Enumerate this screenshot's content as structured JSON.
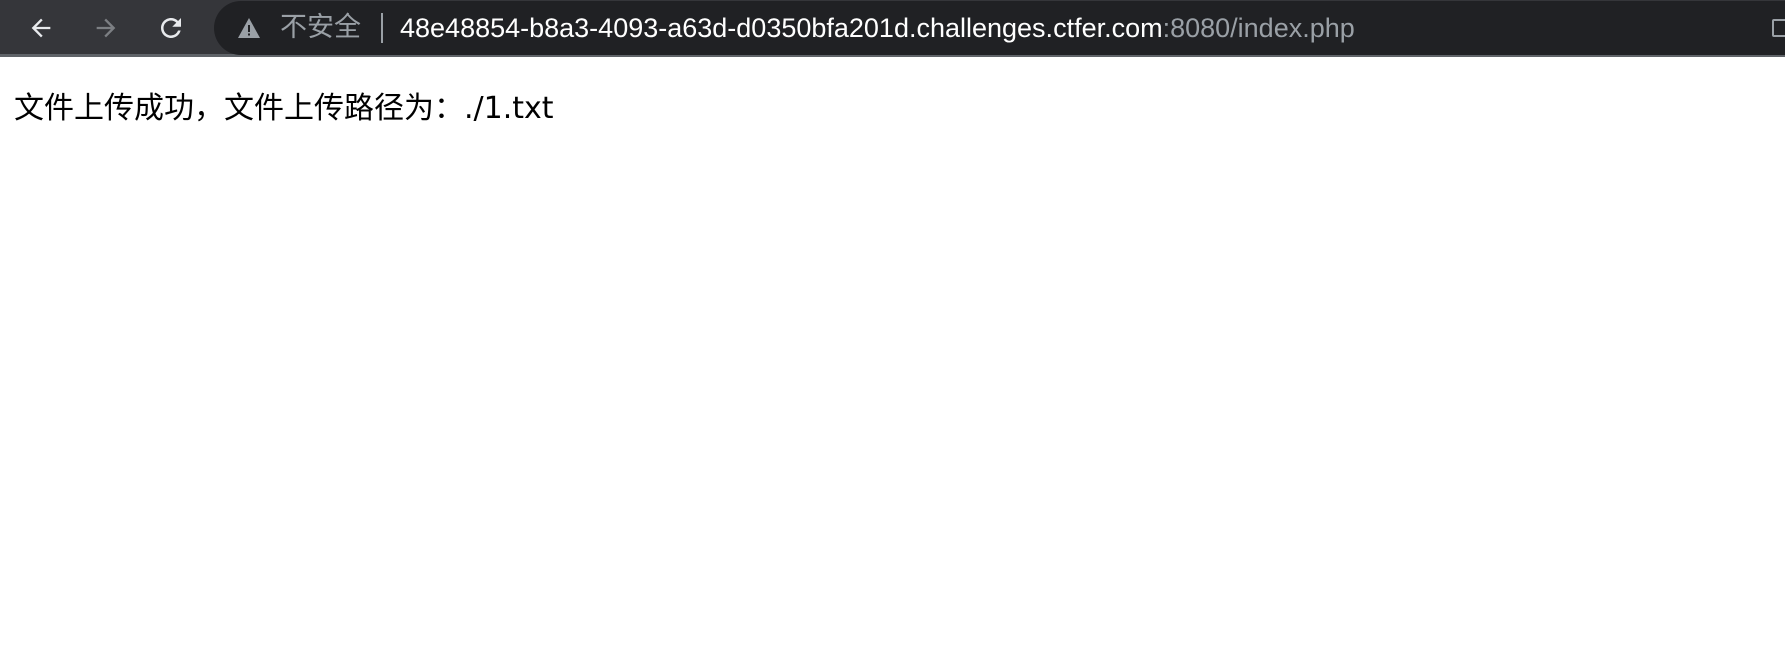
{
  "browser": {
    "security_label": "不安全",
    "url_host": "48e48854-b8a3-4093-a63d-d0350bfa201d.challenges.ctfer.com",
    "url_rest": ":8080/index.php",
    "icons": {
      "back": "arrow-left-icon",
      "forward": "arrow-right-icon",
      "reload": "reload-icon",
      "security": "warning-triangle-icon"
    },
    "colors": {
      "toolbar_bg": "#35363a",
      "omnibox_bg": "#202124",
      "muted_text": "#9aa0a6"
    }
  },
  "page": {
    "message": "文件上传成功，文件上传路径为：./1.txt"
  }
}
